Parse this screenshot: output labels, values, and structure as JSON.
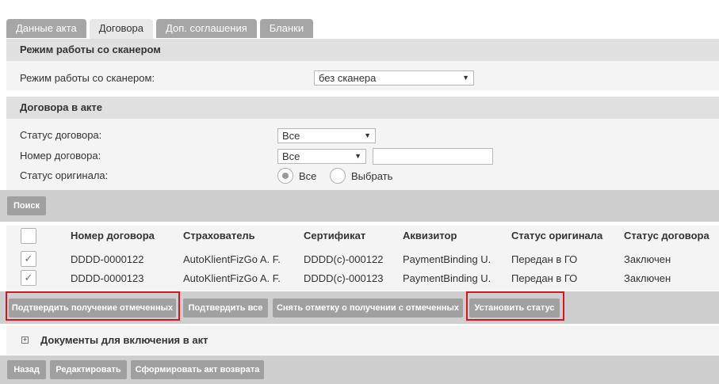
{
  "tabs": [
    "Данные акта",
    "Договора",
    "Доп. соглашения",
    "Бланки"
  ],
  "scanner": {
    "header": "Режим работы со сканером",
    "label": "Режим работы со сканером:",
    "value": "без сканера"
  },
  "contracts": {
    "header": "Договора в акте",
    "status_label": "Статус договора:",
    "status_value": "Все",
    "number_label": "Номер договора:",
    "number_value": "Все",
    "number_input": "",
    "original_label": "Статус оригинала:",
    "radio_all": "Все",
    "radio_select": "Выбрать"
  },
  "search_button": "Поиск",
  "table": {
    "columns": [
      "Номер договора",
      "Страхователь",
      "Сертификат",
      "Аквизитор",
      "Статус оригинала",
      "Статус договора"
    ],
    "rows": [
      {
        "number": "DDDD-0000122",
        "insurer": "AutoKlientFizGo A. F.",
        "certificate": "DDDD(c)-000122",
        "acquirer": "PaymentBinding U.",
        "original_status": "Передан в ГО",
        "contract_status": "Заключен"
      },
      {
        "number": "DDDD-0000123",
        "insurer": "AutoKlientFizGo A. F.",
        "certificate": "DDDD(c)-000123",
        "acquirer": "PaymentBinding U.",
        "original_status": "Передан в ГО",
        "contract_status": "Заключен"
      }
    ]
  },
  "actions": {
    "confirm_selected": "Подтвердить получение отмеченных",
    "confirm_all": "Подтвердить все",
    "unmark_selected": "Снять отметку о получении с отмеченных",
    "set_status": "Установить статус"
  },
  "documents": {
    "expander": "+",
    "header": "Документы для включения в акт"
  },
  "footer": {
    "back": "Назад",
    "edit": "Редактировать",
    "form_return": "Сформировать акт возврата"
  },
  "icons": {
    "check": "✓",
    "dropdown": "▼"
  },
  "colors": {
    "highlight": "#d8141e",
    "button": "#a0a0a0"
  }
}
